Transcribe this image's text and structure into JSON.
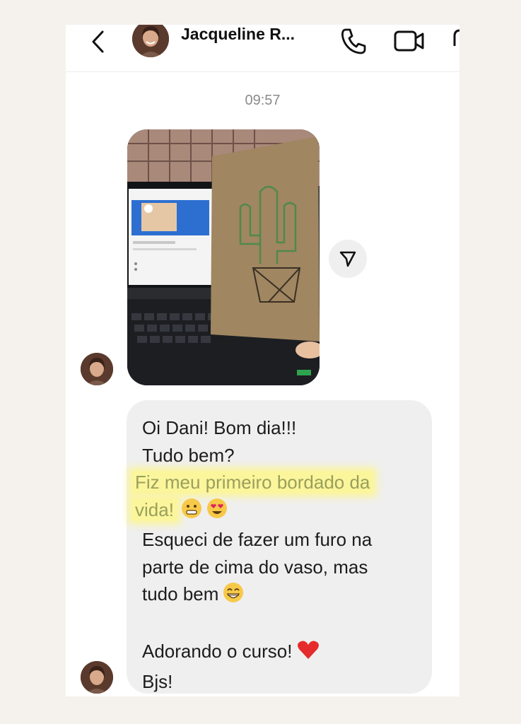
{
  "header": {
    "contact_name": "Jacqueline R..."
  },
  "chat": {
    "timestamp": "09:57",
    "message": {
      "lines": [
        "Oi Dani! Bom dia!!!",
        "Tudo bem?",
        "Fiz meu primeiro bordado da",
        "vida!",
        "Esqueci de fazer um furo na",
        "parte de cima do vaso, mas",
        "tudo bem",
        "",
        "Adorando o curso!",
        "Bjs!"
      ],
      "highlight_color": "#fbf59c"
    }
  },
  "icons": [
    "back-arrow-icon",
    "phone-icon",
    "video-camera-icon",
    "send-icon",
    "grinning-emoji",
    "heart-eyes-emoji",
    "beaming-emoji",
    "red-heart-emoji"
  ]
}
